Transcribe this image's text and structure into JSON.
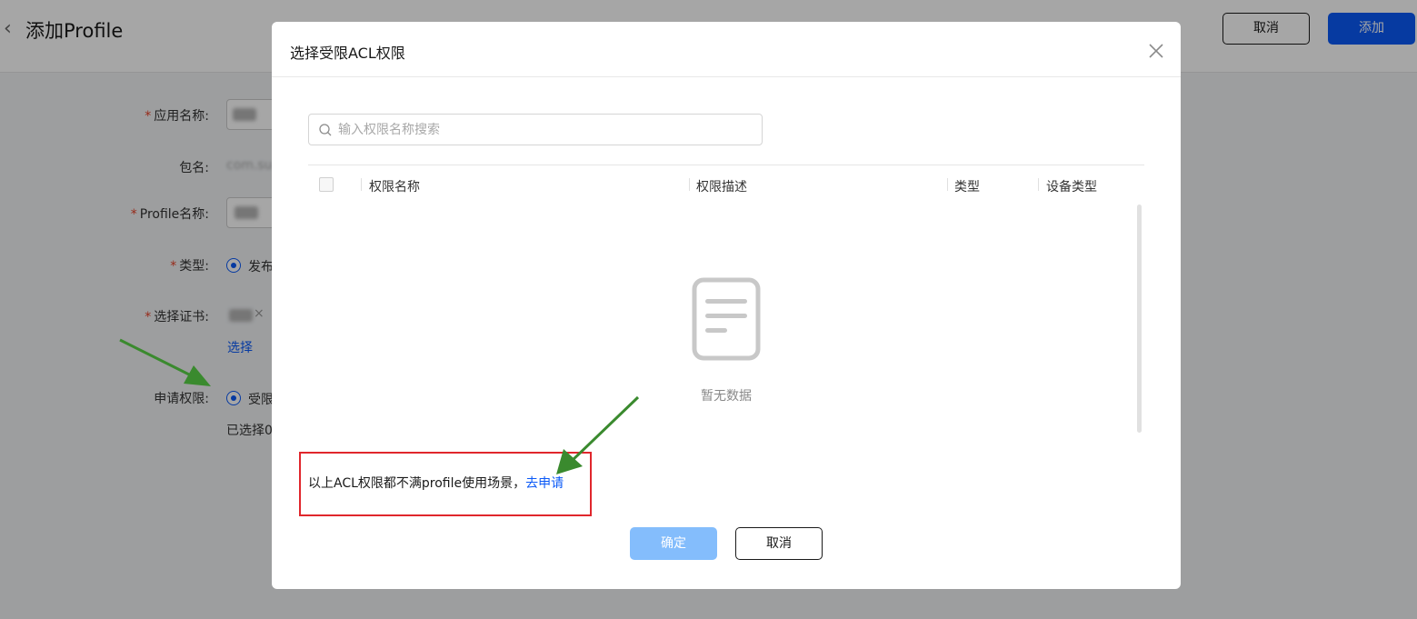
{
  "header": {
    "title": "添加Profile",
    "cancel_label": "取消",
    "add_label": "添加"
  },
  "form": {
    "app_name_label": "应用名称:",
    "package_label": "包名:",
    "package_value": "com.su",
    "profile_name_label": "Profile名称:",
    "type_label": "类型:",
    "type_value": "发布",
    "cert_label": "选择证书:",
    "cert_remove": "×",
    "select_link": "选择",
    "permission_label": "申请权限:",
    "permission_value": "受限",
    "selected_count": "已选择0",
    "required_mark": "*"
  },
  "dialog": {
    "title": "选择受限ACL权限",
    "search_placeholder": "输入权限名称搜索",
    "columns": [
      "权限名称",
      "权限描述",
      "类型",
      "设备类型"
    ],
    "empty_text": "暂无数据",
    "note_text": "以上ACL权限都不满profile使用场景，",
    "note_link": "去申请",
    "ok_label": "确定",
    "cancel_label": "取消"
  },
  "colors": {
    "primary": "#0a59f7",
    "ok_disabled": "#84bdfc",
    "highlight_box": "#e0262c",
    "annotation_arrow": "#3a8a2e"
  }
}
